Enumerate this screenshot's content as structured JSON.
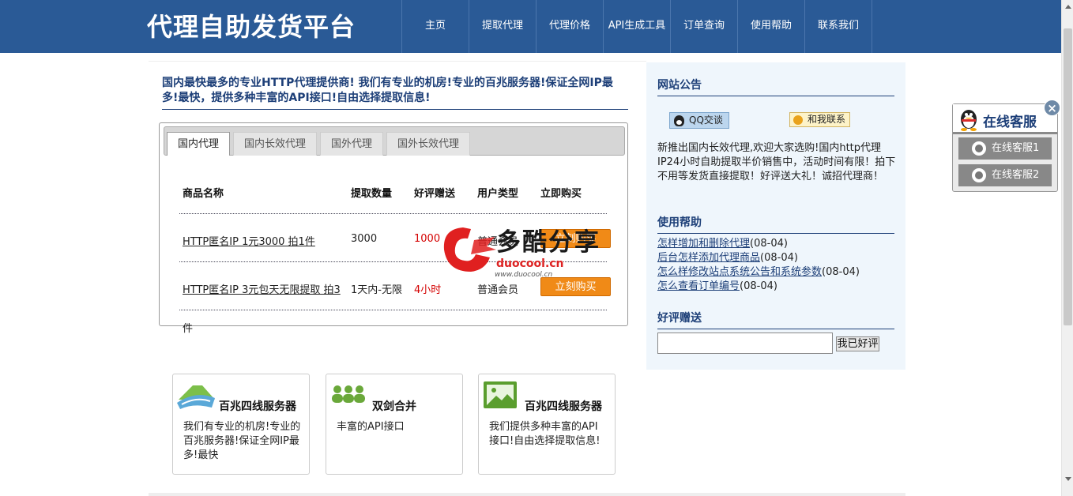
{
  "header": {
    "logo": "代理自助发货平台",
    "nav": [
      "主页",
      "提取代理",
      "代理价格",
      "API生成工具",
      "订单查询",
      "使用帮助",
      "联系我们"
    ]
  },
  "intro": "国内最快最多的专业HTTP代理提供商! 我们有专业的机房!专业的百兆服务器!保证全网IP最多!最快，提供多种丰富的API接口!自由选择提取信息!",
  "tabs": [
    "国内代理",
    "国内长效代理",
    "国外代理",
    "国外长效代理"
  ],
  "table": {
    "headers": [
      "商品名称",
      "提取数量",
      "好评赠送",
      "用户类型",
      "立即购买"
    ],
    "rows": [
      {
        "name": "HTTP匿名IP 1元3000 拍1件",
        "qty": "3000",
        "bonus": "1000",
        "user_type": "普通会员",
        "buy": "立刻购买"
      },
      {
        "name": "HTTP匿名IP 3元包天无限提取 拍3件",
        "name_line1": "HTTP匿名IP 3元包天无限提取 拍3",
        "name_line2": "件",
        "qty": "1天内-无限",
        "bonus": "4小时",
        "user_type": "普通会员",
        "buy": "立刻购买"
      }
    ]
  },
  "sidebar": {
    "notice_title": "网站公告",
    "qq_label": "QQ交谈",
    "contact_label": "和我联系",
    "notice_text": "新推出国内长效代理,欢迎大家选购!国内http代理IP24小时自助提取半价销售中，活动时间有限！拍下不用等发货直接提取！好评送大礼！诚招代理商！",
    "help_title": "使用帮助",
    "help_items": [
      {
        "title": "怎样增加和删除代理",
        "date": "(08-04)"
      },
      {
        "title": "后台怎样添加代理商品",
        "date": "(08-04)"
      },
      {
        "title": "怎么样修改站点系统公告和系统参数",
        "date": "(08-04)"
      },
      {
        "title": "怎么查看订单编号",
        "date": "(08-04)"
      }
    ],
    "review_title": "好评赠送",
    "review_placeholder": "",
    "review_button": "我已好评"
  },
  "features": [
    {
      "title": "百兆四线服务器",
      "text": "我们有专业的机房!专业的百兆服务器!保证全网IP最多!最快",
      "icon": "server-icon"
    },
    {
      "title": "双剑合并",
      "text": "丰富的API接口",
      "icon": "users-icon"
    },
    {
      "title": "百兆四线服务器",
      "text": "我们提供多种丰富的API接口!自由选择提取信息!",
      "icon": "image-icon"
    }
  ],
  "float_service": {
    "title": "在线客服",
    "items": [
      "在线客服1",
      "在线客服2"
    ],
    "close": "×"
  },
  "watermark": {
    "text": "多酷分享",
    "url": "duocool.cn",
    "url_small": "www.duocool.cn"
  },
  "colors": {
    "header_bg": "#2a5a96",
    "accent_red": "#d40000",
    "buy_orange": "#f08a17",
    "sidebar_bg": "#eff6fc"
  }
}
